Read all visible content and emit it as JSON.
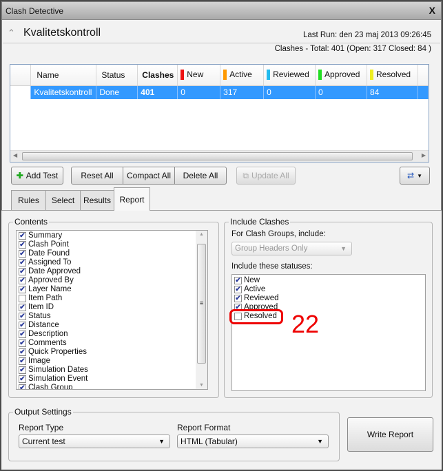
{
  "window": {
    "title": "Clash Detective",
    "close": "X"
  },
  "header": {
    "test_name": "Kvalitetskontroll",
    "last_run": "Last Run:  den 23 maj 2013 09:26:45",
    "clashes_summary": "Clashes -  Total:  401  (Open:  317  Closed:  84 )"
  },
  "grid": {
    "columns": [
      {
        "label": "Name",
        "color": null
      },
      {
        "label": "Status",
        "color": null
      },
      {
        "label": "Clashes",
        "color": null
      },
      {
        "label": "New",
        "color": "#ee1111"
      },
      {
        "label": "Active",
        "color": "#ff9900"
      },
      {
        "label": "Reviewed",
        "color": "#22bbee"
      },
      {
        "label": "Approved",
        "color": "#22dd22"
      },
      {
        "label": "Resolved",
        "color": "#eeee22"
      }
    ],
    "rows": [
      [
        "Kvalitetskontroll",
        "Done",
        "401",
        "0",
        "317",
        "0",
        "0",
        "84"
      ]
    ]
  },
  "toolbar": {
    "add_test": "Add Test",
    "reset_all": "Reset All",
    "compact_all": "Compact All",
    "delete_all": "Delete All",
    "update_all": "Update All"
  },
  "tabs": [
    {
      "label": "Rules"
    },
    {
      "label": "Select"
    },
    {
      "label": "Results"
    },
    {
      "label": "Report",
      "active": true
    }
  ],
  "contents": {
    "title": "Contents",
    "items": [
      {
        "label": "Summary",
        "checked": true
      },
      {
        "label": "Clash Point",
        "checked": true
      },
      {
        "label": "Date Found",
        "checked": true
      },
      {
        "label": "Assigned To",
        "checked": true
      },
      {
        "label": "Date Approved",
        "checked": true
      },
      {
        "label": "Approved By",
        "checked": true
      },
      {
        "label": "Layer Name",
        "checked": true
      },
      {
        "label": "Item Path",
        "checked": false
      },
      {
        "label": "Item ID",
        "checked": true
      },
      {
        "label": "Status",
        "checked": true
      },
      {
        "label": "Distance",
        "checked": true
      },
      {
        "label": "Description",
        "checked": true
      },
      {
        "label": "Comments",
        "checked": true
      },
      {
        "label": "Quick Properties",
        "checked": true
      },
      {
        "label": "Image",
        "checked": true
      },
      {
        "label": "Simulation Dates",
        "checked": true
      },
      {
        "label": "Simulation Event",
        "checked": true
      },
      {
        "label": "Clash Group",
        "checked": true
      }
    ]
  },
  "include": {
    "title": "Include Clashes",
    "groups_label": "For Clash Groups, include:",
    "groups_value": "Group Headers Only",
    "statuses_label": "Include these statuses:",
    "statuses": [
      {
        "label": "New",
        "checked": true
      },
      {
        "label": "Active",
        "checked": true
      },
      {
        "label": "Reviewed",
        "checked": true
      },
      {
        "label": "Approved",
        "checked": true
      },
      {
        "label": "Resolved",
        "checked": false
      }
    ]
  },
  "annotation": {
    "number": "22",
    "color": "#ee0000"
  },
  "output": {
    "title": "Output Settings",
    "report_type_label": "Report Type",
    "report_type_value": "Current test",
    "report_format_label": "Report Format",
    "report_format_value": "HTML (Tabular)",
    "write_report": "Write Report"
  }
}
